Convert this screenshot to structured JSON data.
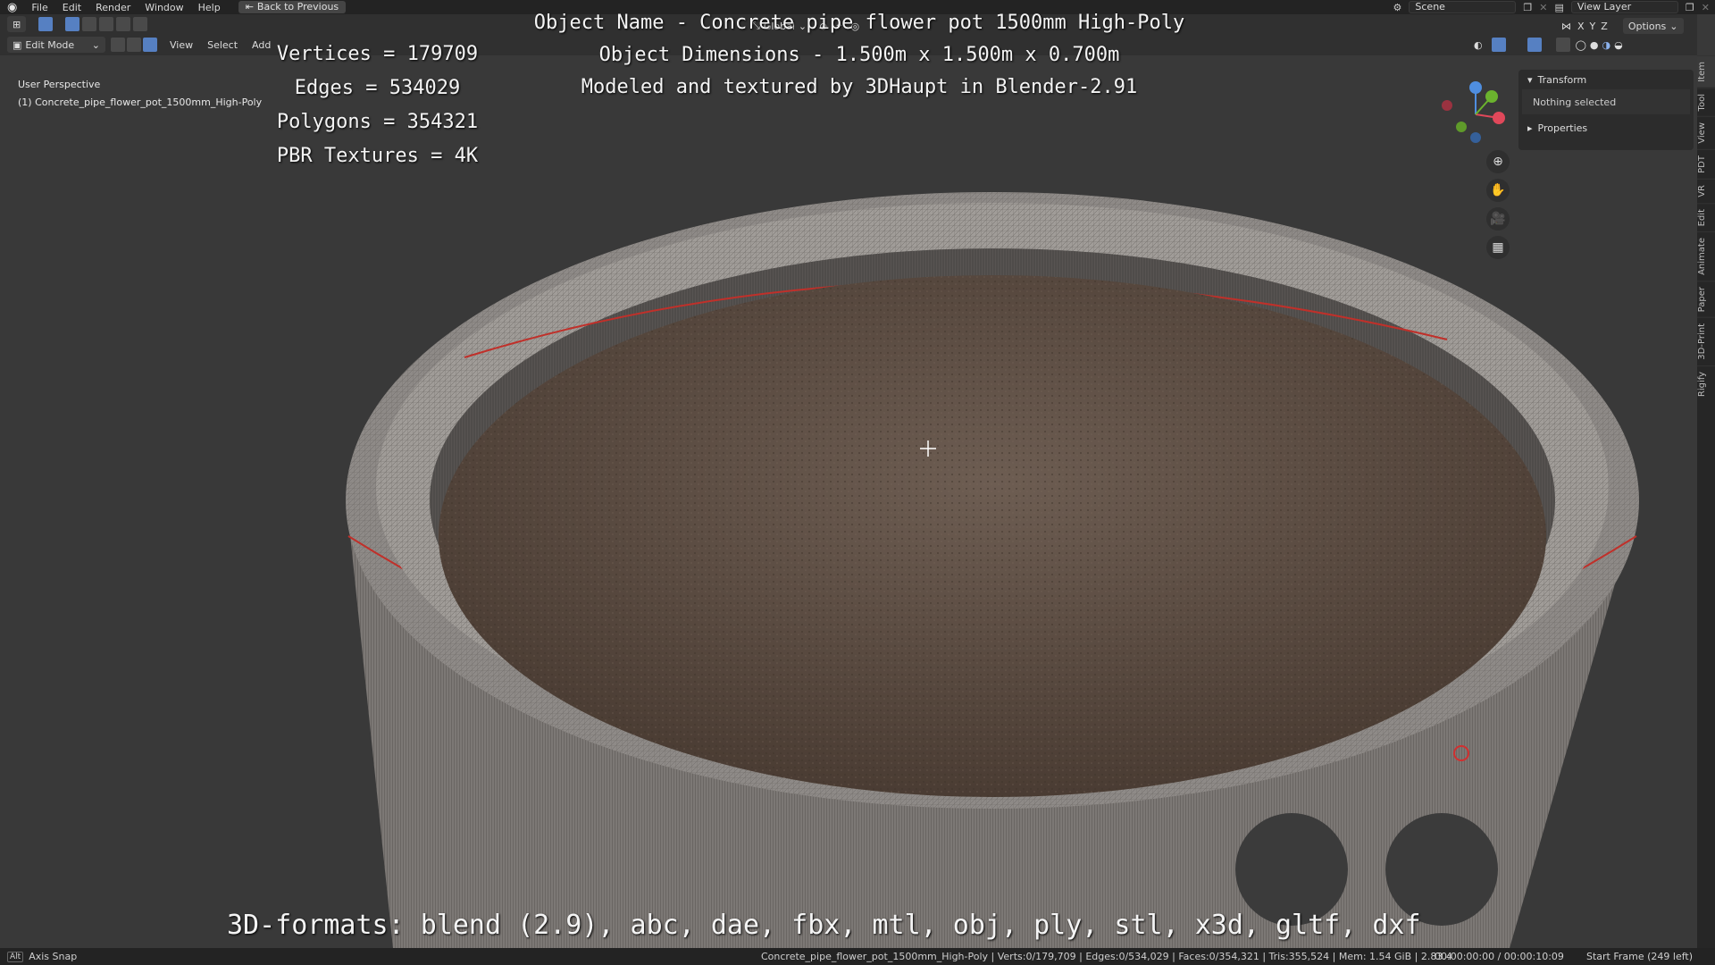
{
  "topbar": {
    "menus": [
      "File",
      "Edit",
      "Render",
      "Window",
      "Help"
    ],
    "back_label": "Back to Previous",
    "scene_label": "Scene",
    "view_layer_label": "View Layer"
  },
  "header": {
    "mode": "Edit Mode",
    "menus": [
      "View",
      "Select",
      "Add"
    ],
    "transform_orientation": "Global",
    "axes": [
      "X",
      "Y",
      "Z"
    ],
    "options_label": "Options"
  },
  "viewport": {
    "perspective": "User Perspective",
    "object_label": "(1) Concrete_pipe_flower_pot_1500mm_High-Poly"
  },
  "overlay": {
    "stats": [
      "Vertices = 179709",
      "Edges = 534029",
      "Polygons = 354321",
      "PBR Textures = 4K"
    ],
    "info": [
      "Object Name - Concrete pipe flower pot 1500mm High-Poly",
      "Object Dimensions -  1.500m x 1.500m x 0.700m",
      "Modeled and textured by 3DHaupt in Blender-2.91"
    ],
    "formats": "3D-formats: blend (2.9), abc, dae, fbx, mtl, obj, ply, stl, x3d, gltf, dxf"
  },
  "npanel": {
    "transform_label": "Transform",
    "nothing_selected": "Nothing selected",
    "properties_label": "Properties",
    "tabs": [
      "Item",
      "Tool",
      "View",
      "PDT",
      "VR",
      "Edit",
      "Animate",
      "Paper",
      "3D-Print",
      "Rigify"
    ]
  },
  "statusbar": {
    "axis_snap": "Axis Snap",
    "alt_key": "Alt",
    "stats": "Concrete_pipe_flower_pot_1500mm_High-Poly | Verts:0/179,709 | Edges:0/534,029 | Faces:0/354,321 | Tris:355,524 | Mem: 1.54 GiB | 2.83.4",
    "time": "00:00:00:00 / 00:00:10:09",
    "frame": "Start Frame (249 left)"
  },
  "colors": {
    "background": "#393939",
    "soil": "#5a4a40",
    "concrete": "#8a8683",
    "seam": "#c0302a"
  }
}
